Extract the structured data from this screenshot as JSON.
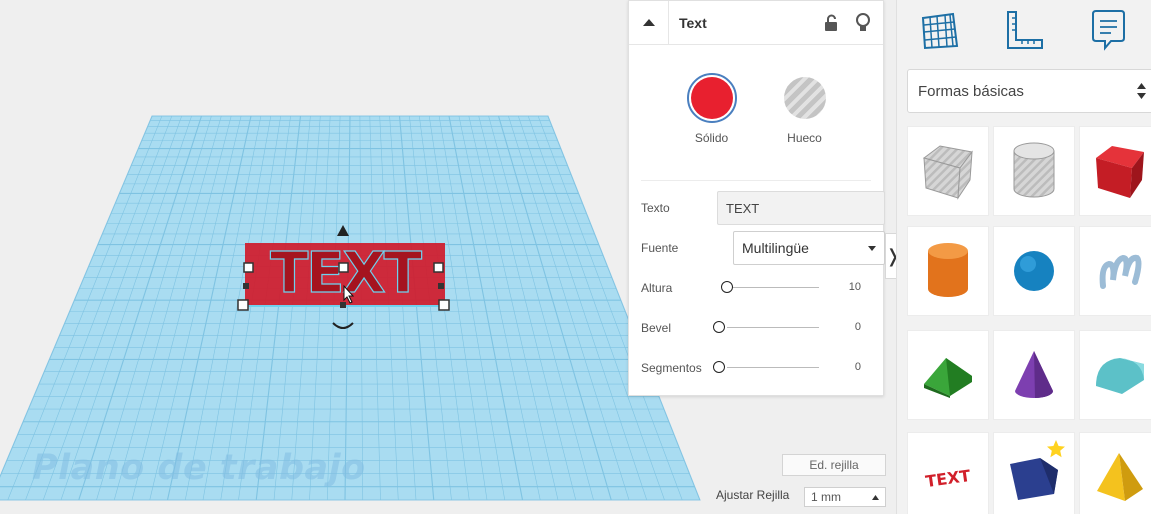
{
  "workplane": {
    "label": "Plano de trabajo"
  },
  "inspector": {
    "title": "Text",
    "swatches": [
      {
        "label": "Sólido",
        "color": "#e8202f",
        "selected": true
      },
      {
        "label": "Hueco",
        "color": "#bdbdbd",
        "selected": false
      }
    ],
    "texto": {
      "label": "Texto",
      "value": "TEXT"
    },
    "fuente": {
      "label": "Fuente",
      "value": "Multilingüe"
    },
    "altura": {
      "label": "Altura",
      "value": "10"
    },
    "bevel": {
      "label": "Bevel",
      "value": "0"
    },
    "segmentos": {
      "label": "Segmentos",
      "value": "0"
    }
  },
  "grid_controls": {
    "edit_label": "Ed. rejilla",
    "snap_label": "Ajustar Rejilla",
    "snap_value": "1 mm"
  },
  "shapes": {
    "library": "Formas básicas",
    "tiles": [
      {
        "name": "box-hole",
        "color": "#c8c8c8"
      },
      {
        "name": "cylinder-hole",
        "color": "#d0d0d0"
      },
      {
        "name": "box",
        "color": "#d61f26"
      },
      {
        "name": "cylinder",
        "color": "#e8761e"
      },
      {
        "name": "sphere",
        "color": "#1e8fc9"
      },
      {
        "name": "scribble",
        "color": "#9fbfd8"
      },
      {
        "name": "roof",
        "color": "#3aa33a"
      },
      {
        "name": "cone",
        "color": "#7b3fa8"
      },
      {
        "name": "round-roof",
        "color": "#5fc0c8"
      },
      {
        "name": "text",
        "color": "#d61f26",
        "label": "TEXT"
      },
      {
        "name": "polygon",
        "color": "#2a3f8f"
      },
      {
        "name": "pyramid",
        "color": "#f2c01c"
      }
    ],
    "accent": "#ffd21f"
  }
}
